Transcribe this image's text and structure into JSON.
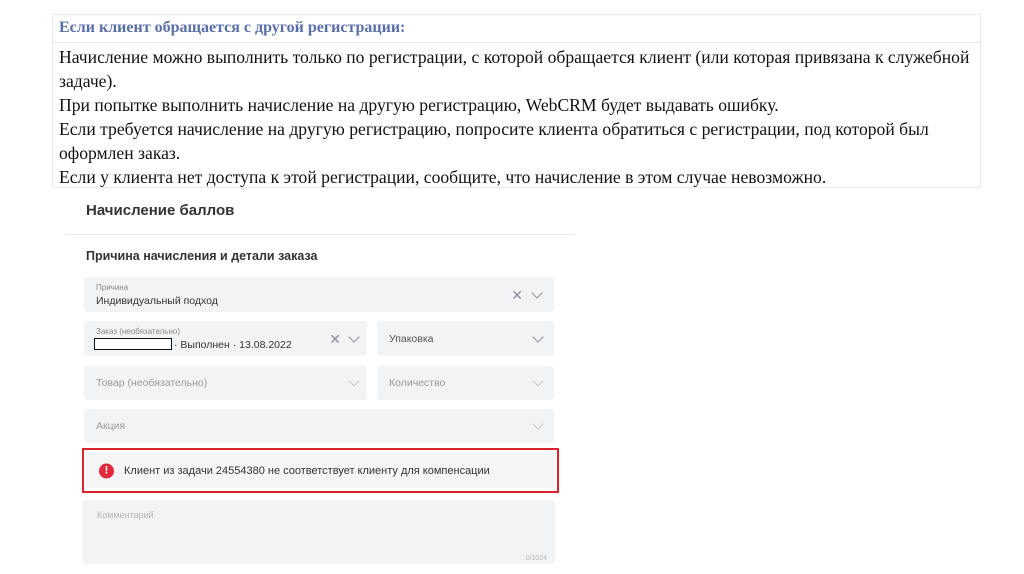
{
  "note": {
    "heading": "Если клиент обращается с другой регистрации:",
    "paragraphs": [
      "Начисление можно выполнить только по регистрации, с которой обращается клиент (или которая привязана к служебной задаче).",
      "При попытке выполнить начисление на другую регистрацию, WebCRM будет выдавать ошибку.",
      "Если требуется начисление на другую регистрацию, попросите клиента обратиться с регистрации, под которой был оформлен заказ.",
      "Если у клиента нет доступа к этой регистрации, сообщите, что начисление в этом случае невозможно."
    ]
  },
  "form": {
    "title": "Начисление баллов",
    "section_title": "Причина начисления и детали заказа",
    "reason": {
      "label": "Причина",
      "value": "Индивидуальный подход"
    },
    "order": {
      "label": "Заказ (необязательно)",
      "value_suffix": "· Выполнен · 13.08.2022"
    },
    "packaging": {
      "placeholder": "Упаковка"
    },
    "product": {
      "placeholder": "Товар (необязательно)"
    },
    "quantity": {
      "placeholder": "Количество"
    },
    "promo": {
      "placeholder": "Акция"
    },
    "error": {
      "icon": "!",
      "message": "Клиент из задачи 24554380 не соответствует клиенту для компенсации"
    },
    "comment": {
      "placeholder": "Комментарий",
      "counter": "0/1024"
    },
    "icons": {
      "clear": "✕",
      "dropdown": "chevron-down-icon"
    },
    "colors": {
      "error_border": "#d9242e",
      "error_icon": "#e0293b",
      "heading": "#5a6fa8"
    }
  }
}
